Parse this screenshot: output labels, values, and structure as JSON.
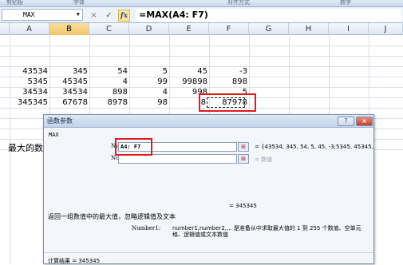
{
  "ribbon": {
    "groups": [
      "剪贴板",
      "字体",
      "对齐方式",
      "数字"
    ]
  },
  "formula_bar": {
    "name_box": "MAX",
    "cancel_icon": "×",
    "enter_icon": "✓",
    "fx_label": "fx",
    "formula": "=MAX(A4: F7)"
  },
  "columns": [
    "A",
    "B",
    "C",
    "D",
    "E",
    "F",
    "G",
    "H",
    "I",
    "J"
  ],
  "selected_column": "B",
  "rows": [
    [
      "43534",
      "345",
      "54",
      "5",
      "45",
      "-3"
    ],
    [
      "5345",
      "45345",
      "4",
      "99",
      "99898",
      "898"
    ],
    [
      "34534",
      "34534",
      "898",
      "4",
      "998",
      "5"
    ],
    [
      "345345",
      "67678",
      "8978",
      "98",
      "8",
      "87978"
    ]
  ],
  "side_text": "最大的数",
  "dialog": {
    "title": "函数参数",
    "help_label": "?",
    "close_label": "×",
    "function_name": "MAX",
    "args": [
      {
        "label": "Number1",
        "value": "A4: F7",
        "result": "= {43534, 345, 54, 5, 45, -3;5345, 45345,"
      },
      {
        "label": "Number2",
        "value": "",
        "result": "= 数值"
      }
    ],
    "formula_result": "= 345345",
    "description": "返回一组数值中的最大值，忽略逻辑值及文本",
    "param_label": "Number1:",
    "param_description": "number1,number2,... 是准备从中求取最大值的 1 到 255 个数值、空单元格、逻辑值或文本数值",
    "calc_result": "计算结果 = 345345"
  },
  "colors": {
    "highlight_red": "#e11a1a",
    "header_selected": "#f2c46a"
  }
}
